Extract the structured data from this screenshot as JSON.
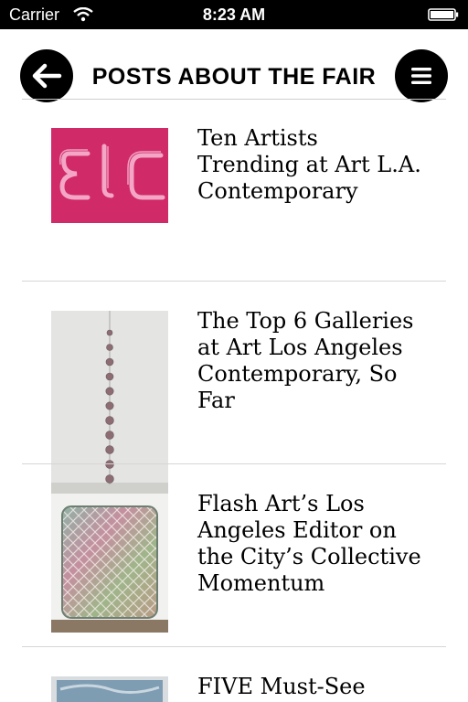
{
  "status_bar": {
    "carrier": "Carrier",
    "time": "8:23 AM"
  },
  "nav": {
    "title": "POSTS ABOUT THE FAIR",
    "back_icon": "arrow-left-icon",
    "menu_icon": "hamburger-icon"
  },
  "posts": [
    {
      "title": "Ten Artists Trending at Art L.A. Contemporary"
    },
    {
      "title": "The Top 6 Galleries at Art Los Angeles Contemporary, So Far"
    },
    {
      "title": "Flash Art’s Los Angeles Editor on the City’s Collective Momentum"
    },
    {
      "title": "FIVE Must-See"
    }
  ],
  "colors": {
    "status_bar_bg": "#000000",
    "accent_pink": "#d4306e",
    "divider": "#d6d6d6"
  }
}
